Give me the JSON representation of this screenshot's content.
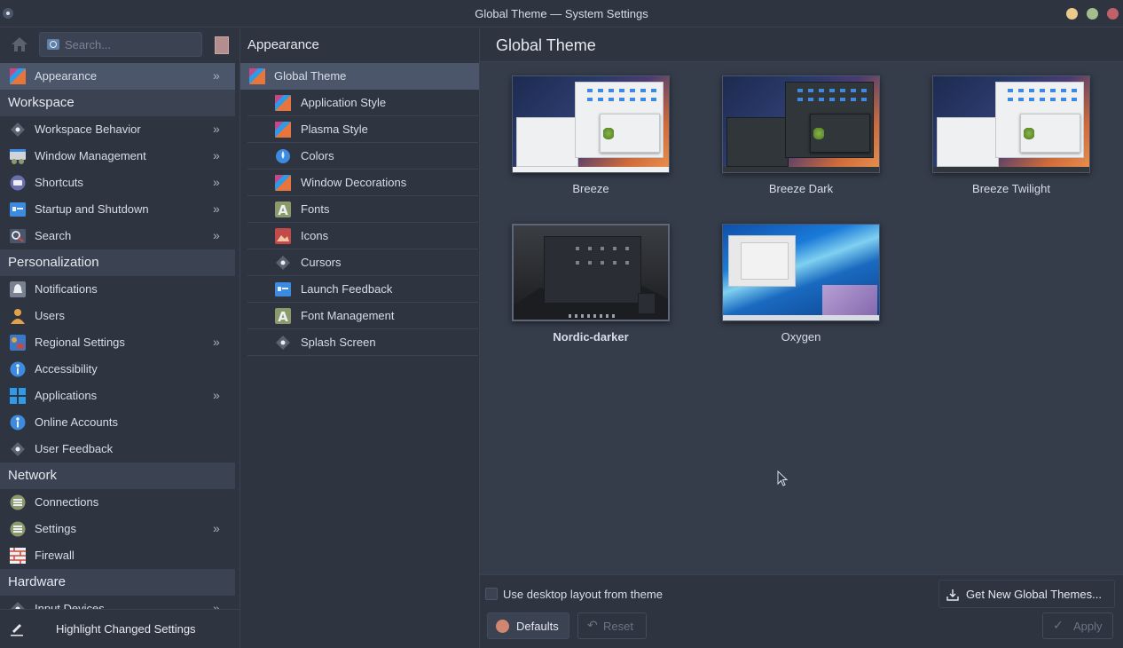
{
  "window": {
    "title": "Global Theme — System Settings"
  },
  "sidebar": {
    "search_placeholder": "Search...",
    "items": [
      {
        "type": "item",
        "label": "Appearance",
        "icon": "appearance-icon",
        "chevron": true,
        "selected": true,
        "color": "#e8753b"
      },
      {
        "type": "header",
        "label": "Workspace"
      },
      {
        "type": "item",
        "label": "Workspace Behavior",
        "icon": "workspace-behavior-icon",
        "chevron": true,
        "color": "#5b6270"
      },
      {
        "type": "item",
        "label": "Window Management",
        "icon": "window-management-icon",
        "chevron": true,
        "color": "#d0d4da"
      },
      {
        "type": "item",
        "label": "Shortcuts",
        "icon": "shortcuts-icon",
        "chevron": true,
        "color": "#6a6fb0"
      },
      {
        "type": "item",
        "label": "Startup and Shutdown",
        "icon": "startup-icon",
        "chevron": true,
        "color": "#3d8be0"
      },
      {
        "type": "item",
        "label": "Search",
        "icon": "search-icon",
        "chevron": true,
        "color": "#c24a4a"
      },
      {
        "type": "header",
        "label": "Personalization"
      },
      {
        "type": "item",
        "label": "Notifications",
        "icon": "bell-icon",
        "chevron": false,
        "color": "#7a8190"
      },
      {
        "type": "item",
        "label": "Users",
        "icon": "user-icon",
        "chevron": false,
        "color": "#e3a14a"
      },
      {
        "type": "item",
        "label": "Regional Settings",
        "icon": "regional-settings-icon",
        "chevron": true,
        "color": "#3a78c8"
      },
      {
        "type": "item",
        "label": "Accessibility",
        "icon": "accessibility-icon",
        "chevron": false,
        "color": "#3d8be0"
      },
      {
        "type": "item",
        "label": "Applications",
        "icon": "applications-icon",
        "chevron": true,
        "color": "#2f9be8"
      },
      {
        "type": "item",
        "label": "Online Accounts",
        "icon": "online-accounts-icon",
        "chevron": false,
        "color": "#3d8be0"
      },
      {
        "type": "item",
        "label": "User Feedback",
        "icon": "user-feedback-icon",
        "chevron": false,
        "color": "#5b6270"
      },
      {
        "type": "header",
        "label": "Network"
      },
      {
        "type": "item",
        "label": "Connections",
        "icon": "connections-icon",
        "chevron": false,
        "color": "#8a9a6a"
      },
      {
        "type": "item",
        "label": "Settings",
        "icon": "network-settings-icon",
        "chevron": true,
        "color": "#8a9a6a"
      },
      {
        "type": "item",
        "label": "Firewall",
        "icon": "firewall-icon",
        "chevron": false,
        "color": "#d24a3a"
      },
      {
        "type": "header",
        "label": "Hardware"
      },
      {
        "type": "item",
        "label": "Input Devices",
        "icon": "input-devices-icon",
        "chevron": true,
        "color": "#5b6270"
      }
    ],
    "bottom_label": "Highlight Changed Settings"
  },
  "middle": {
    "title": "Appearance",
    "items": [
      {
        "label": "Global Theme",
        "icon": "global-theme-icon",
        "selected": true,
        "indent": false,
        "color": "#e8753b"
      },
      {
        "label": "Application Style",
        "icon": "application-style-icon",
        "indent": true,
        "color": "#e8753b"
      },
      {
        "label": "Plasma Style",
        "icon": "plasma-style-icon",
        "indent": true,
        "color": "#e8753b"
      },
      {
        "label": "Colors",
        "icon": "colors-icon",
        "indent": true,
        "color": "#3d8be0"
      },
      {
        "label": "Window Decorations",
        "icon": "window-decorations-icon",
        "indent": true,
        "color": "#e8753b"
      },
      {
        "label": "Fonts",
        "icon": "fonts-icon",
        "indent": true,
        "color": "#8a9a6a"
      },
      {
        "label": "Icons",
        "icon": "icons-icon",
        "indent": true,
        "color": "#c24a4a"
      },
      {
        "label": "Cursors",
        "icon": "cursors-icon",
        "indent": true,
        "color": "#5b6270"
      },
      {
        "label": "Launch Feedback",
        "icon": "launch-feedback-icon",
        "indent": true,
        "color": "#3d8be0"
      },
      {
        "label": "Font Management",
        "icon": "font-management-icon",
        "indent": true,
        "color": "#8a9a6a"
      },
      {
        "label": "Splash Screen",
        "icon": "splash-screen-icon",
        "indent": true,
        "color": "#5b6270"
      }
    ]
  },
  "content": {
    "title": "Global Theme",
    "themes": [
      {
        "name": "Breeze",
        "style": "breeze-light",
        "bold": false
      },
      {
        "name": "Breeze Dark",
        "style": "breeze-dark",
        "bold": false
      },
      {
        "name": "Breeze Twilight",
        "style": "breeze-twilight",
        "bold": false
      },
      {
        "name": "Nordic-darker",
        "style": "nordic",
        "bold": true
      },
      {
        "name": "Oxygen",
        "style": "oxygen",
        "bold": false
      }
    ],
    "use_desktop_layout_label": "Use desktop layout from theme",
    "use_desktop_layout_checked": false,
    "get_new_label": "Get New Global Themes...",
    "defaults_label": "Defaults",
    "reset_label": "Reset",
    "apply_label": "Apply"
  },
  "colors": {
    "background": "#2e3440",
    "selection": "#4c566a",
    "accent": "#88c0d0"
  }
}
